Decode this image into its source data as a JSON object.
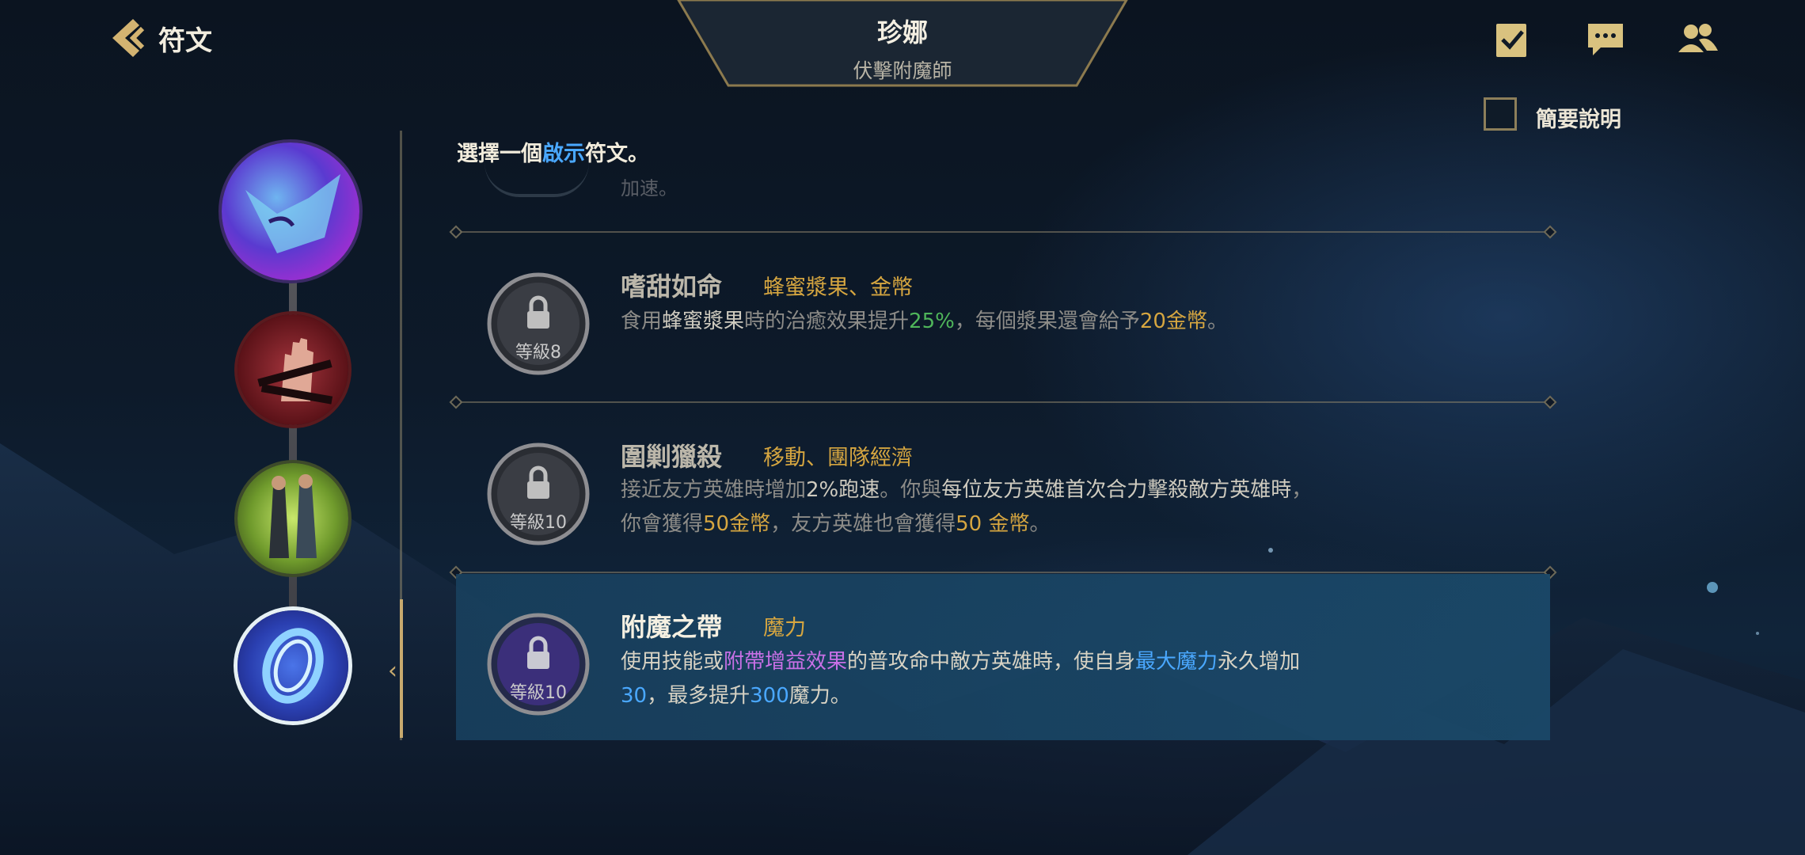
{
  "header": {
    "back_icon": "chevron-left-icon",
    "title": "符文",
    "champion_name": "珍娜",
    "champion_subtitle": "伏擊附魔師",
    "icons": [
      "checklist-icon",
      "chat-icon",
      "friends-icon"
    ]
  },
  "summary": {
    "label": "簡要說明",
    "checked": false
  },
  "prompt": {
    "before": "選擇一個",
    "highlight": "啟示",
    "after": "符文。"
  },
  "partial_row": {
    "text": "加速。"
  },
  "runes": [
    {
      "name": "嗜甜如命",
      "tags": "蜂蜜漿果、金幣",
      "lock_level": "等級8",
      "desc_lines": [
        [
          {
            "t": "食用",
            "c": ""
          },
          {
            "t": "蜂蜜漿果",
            "c": "w"
          },
          {
            "t": "時的治癒效果提升",
            "c": ""
          },
          {
            "t": "25%",
            "c": "g"
          },
          {
            "t": "，每個漿果還會給予",
            "c": ""
          },
          {
            "t": "20金幣",
            "c": "y"
          },
          {
            "t": "。",
            "c": ""
          }
        ]
      ]
    },
    {
      "name": "圍剿獵殺",
      "tags": "移動、團隊經濟",
      "lock_level": "等級10",
      "desc_lines": [
        [
          {
            "t": "接近友方英雄時增加",
            "c": ""
          },
          {
            "t": "2%跑速",
            "c": "w"
          },
          {
            "t": "。你與",
            "c": ""
          },
          {
            "t": "每位友方英雄首次合力擊殺敵方英雄時",
            "c": "w"
          },
          {
            "t": "，",
            "c": ""
          }
        ],
        [
          {
            "t": "你會獲得",
            "c": ""
          },
          {
            "t": "50金幣",
            "c": "y"
          },
          {
            "t": "，友方英雄也會獲得",
            "c": ""
          },
          {
            "t": "50 金幣",
            "c": "y"
          },
          {
            "t": "。",
            "c": ""
          }
        ]
      ]
    },
    {
      "name": "附魔之帶",
      "tags": "魔力",
      "lock_level": "等級10",
      "desc_lines": [
        [
          {
            "t": "使用技能或",
            "c": ""
          },
          {
            "t": "附帶增益效果",
            "c": "p"
          },
          {
            "t": "的普攻命中敵方英雄時，使自身",
            "c": ""
          },
          {
            "t": "最大魔力",
            "c": "b"
          },
          {
            "t": "永久增加",
            "c": ""
          }
        ],
        [
          {
            "t": "30",
            "c": "b"
          },
          {
            "t": "，最多提升",
            "c": ""
          },
          {
            "t": "300",
            "c": "b"
          },
          {
            "t": "魔力。",
            "c": ""
          }
        ]
      ]
    }
  ],
  "left_rail": {
    "items": [
      "keystone-fox-icon",
      "domination-hand-icon",
      "resolve-duo-icon",
      "inspiration-band-icon"
    ],
    "selected_index": 3
  },
  "colors": {
    "gold_accent": "#c8aa6e",
    "highlight_blue": "#4aa8ff",
    "tag_gold": "#d6a640",
    "green": "#4fb65a",
    "purple": "#c870e6"
  }
}
